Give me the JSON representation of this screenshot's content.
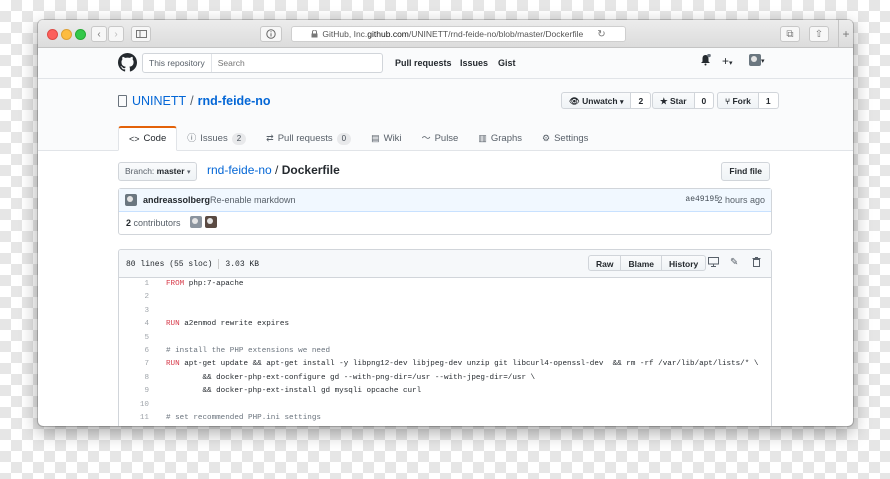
{
  "browser": {
    "url_prefix": "GitHub, Inc. ",
    "url_host": "github.com",
    "url_path": "/UNINETT/rnd-feide-no/blob/master/Dockerfile"
  },
  "header": {
    "search_scope": "This repository",
    "search_placeholder": "Search",
    "nav": [
      "Pull requests",
      "Issues",
      "Gist"
    ]
  },
  "repo": {
    "owner": "UNINETT",
    "separator": "/",
    "name": "rnd-feide-no",
    "watch_label": "Unwatch",
    "watch_count": "2",
    "star_label": "Star",
    "star_count": "0",
    "fork_label": "Fork",
    "fork_count": "1"
  },
  "tabs": [
    {
      "label": "Code",
      "icon": "code-icon",
      "selected": true,
      "counter": ""
    },
    {
      "label": "Issues",
      "icon": "issue-icon",
      "counter": "2"
    },
    {
      "label": "Pull requests",
      "icon": "pull-request-icon",
      "counter": "0"
    },
    {
      "label": "Wiki",
      "icon": "wiki-icon",
      "counter": ""
    },
    {
      "label": "Pulse",
      "icon": "pulse-icon",
      "counter": ""
    },
    {
      "label": "Graphs",
      "icon": "graph-icon",
      "counter": ""
    },
    {
      "label": "Settings",
      "icon": "gear-icon",
      "counter": ""
    }
  ],
  "file_nav": {
    "branch_prefix": "Branch:",
    "branch": "master",
    "path_repo": "rnd-feide-no",
    "path_sep": " / ",
    "path_file": "Dockerfile",
    "find_file": "Find file"
  },
  "commit": {
    "author": "andreassolberg",
    "message": "Re-enable markdown",
    "sha": "ae49195",
    "time": "2 hours ago",
    "contributors_count": "2",
    "contributors_label": "contributors"
  },
  "file": {
    "lines_info": "80 lines (55 sloc)",
    "size": "3.03 KB",
    "buttons": [
      "Raw",
      "Blame",
      "History"
    ],
    "code": [
      {
        "n": "1",
        "parts": [
          {
            "t": "FROM",
            "c": "kw"
          },
          {
            "t": " php:7-apache",
            "c": ""
          }
        ]
      },
      {
        "n": "2",
        "parts": []
      },
      {
        "n": "3",
        "parts": []
      },
      {
        "n": "4",
        "parts": [
          {
            "t": "RUN",
            "c": "kw"
          },
          {
            "t": " a2enmod rewrite expires",
            "c": ""
          }
        ]
      },
      {
        "n": "5",
        "parts": []
      },
      {
        "n": "6",
        "parts": [
          {
            "t": "# install the PHP extensions we need",
            "c": "cm"
          }
        ]
      },
      {
        "n": "7",
        "parts": [
          {
            "t": "RUN",
            "c": "kw"
          },
          {
            "t": " apt-get update && apt-get install -y libpng12-dev libjpeg-dev unzip git libcurl4-openssl-dev  && rm -rf /var/lib/apt/lists/* \\",
            "c": ""
          }
        ]
      },
      {
        "n": "8",
        "parts": [
          {
            "t": "        && docker-php-ext-configure gd --with-png-dir=/usr --with-jpeg-dir=/usr \\",
            "c": ""
          }
        ]
      },
      {
        "n": "9",
        "parts": [
          {
            "t": "        && docker-php-ext-install gd mysqli opcache curl",
            "c": ""
          }
        ]
      },
      {
        "n": "10",
        "parts": []
      },
      {
        "n": "11",
        "parts": [
          {
            "t": "# set recommended PHP.ini settings",
            "c": "cm"
          }
        ]
      }
    ]
  },
  "colors": {
    "link": "#0366d6",
    "keyword": "#d73a49",
    "comment": "#6a737d",
    "tab_accent": "#e36209"
  }
}
